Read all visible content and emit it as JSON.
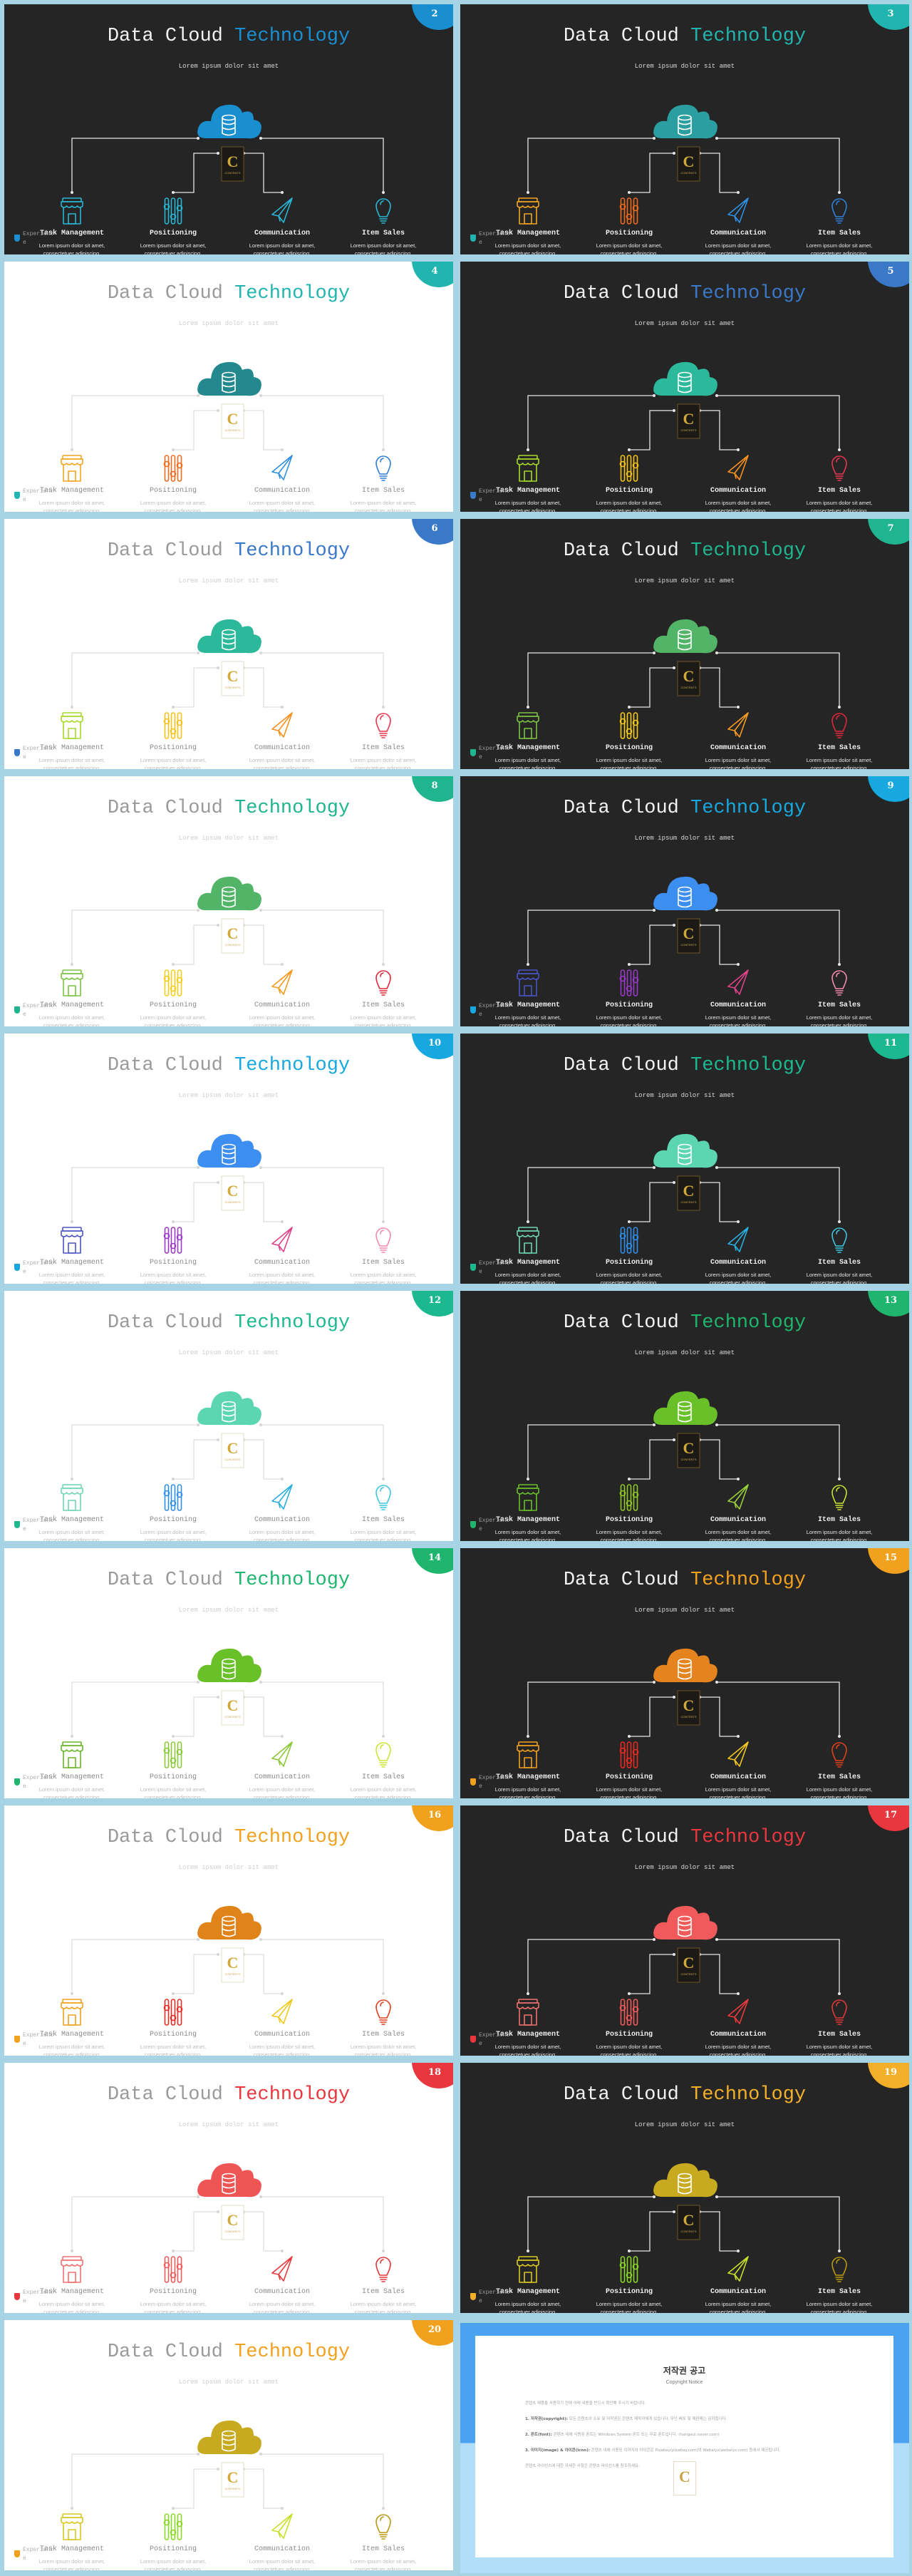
{
  "common": {
    "title_main": "Data Cloud",
    "title_accent": "Technology",
    "subtitle": "Lorem ipsum dolor sit amet",
    "items": [
      {
        "label": "Task Management",
        "icon": "store-icon",
        "desc_line1": "Lorem ipsum dolor sit amet,",
        "desc_line2": "consectetuer adipiscing."
      },
      {
        "label": "Positioning",
        "icon": "sliders-icon",
        "desc_line1": "Lorem ipsum dolor sit amet,",
        "desc_line2": "consectetuer adipiscing."
      },
      {
        "label": "Communication",
        "icon": "paper-plane-icon",
        "desc_line1": "Lorem ipsum dolor sit amet,",
        "desc_line2": "consectetuer adipiscing."
      },
      {
        "label": "Item Sales",
        "icon": "lightbulb-icon",
        "desc_line1": "Lorem ipsum dolor sit amet,",
        "desc_line2": "consectetuer adipiscing."
      }
    ],
    "center_icon": "database-cloud-icon",
    "logo_letter": "C",
    "logo_text": "CONTENTS",
    "footer_text": "Experience"
  },
  "slides": [
    {
      "number": "2",
      "theme": "dark",
      "accent": "#1a8fd0",
      "cloud": "#1a8fd0",
      "icons": [
        "#29b6d6",
        "#29b6d6",
        "#29b6d6",
        "#29b6d6"
      ]
    },
    {
      "number": "3",
      "theme": "dark",
      "accent": "#22b5b0",
      "cloud": "#2a9ea0",
      "icons": [
        "#f2a51f",
        "#f06a1e",
        "#2f8fe0",
        "#2f7fd6"
      ]
    },
    {
      "number": "4",
      "theme": "light",
      "accent": "#22b5b0",
      "cloud": "#24898f",
      "icons": [
        "#f2a51f",
        "#f06a1e",
        "#2f8fe0",
        "#2f7fd6"
      ]
    },
    {
      "number": "5",
      "theme": "dark",
      "accent": "#3a78c8",
      "cloud": "#2cb89a",
      "icons": [
        "#a8d82a",
        "#f5c21a",
        "#f6901e",
        "#e8364f"
      ]
    },
    {
      "number": "6",
      "theme": "light",
      "accent": "#3a78c8",
      "cloud": "#2cb89a",
      "icons": [
        "#a8d82a",
        "#f5c21a",
        "#f6901e",
        "#e8364f"
      ]
    },
    {
      "number": "7",
      "theme": "dark",
      "accent": "#1fb58f",
      "cloud": "#52b466",
      "icons": [
        "#7cc242",
        "#f6cc1a",
        "#f69a1e",
        "#e0283a"
      ]
    },
    {
      "number": "8",
      "theme": "light",
      "accent": "#1fb58f",
      "cloud": "#52b466",
      "icons": [
        "#7cc242",
        "#f6cc1a",
        "#f69a1e",
        "#e0283a"
      ]
    },
    {
      "number": "9",
      "theme": "dark",
      "accent": "#17a8e0",
      "cloud": "#3c8ef0",
      "icons": [
        "#4a54c8",
        "#9a38c8",
        "#e0428a",
        "#f28ab0"
      ]
    },
    {
      "number": "10",
      "theme": "light",
      "accent": "#17a8e0",
      "cloud": "#3c8ef0",
      "icons": [
        "#4a54c8",
        "#9a38c8",
        "#e0428a",
        "#f28ab0"
      ]
    },
    {
      "number": "11",
      "theme": "dark",
      "accent": "#1cb890",
      "cloud": "#5cd6b0",
      "icons": [
        "#6fd6b0",
        "#2f8fe8",
        "#29aee0",
        "#3cc6e0"
      ]
    },
    {
      "number": "12",
      "theme": "light",
      "accent": "#1cb890",
      "cloud": "#5cd6b0",
      "icons": [
        "#6fd6b0",
        "#2f8fe8",
        "#29aee0",
        "#3cc6e0"
      ]
    },
    {
      "number": "13",
      "theme": "dark",
      "accent": "#1fb56e",
      "cloud": "#6ac028",
      "icons": [
        "#6ac028",
        "#90c828",
        "#9ad03a",
        "#c8e030"
      ]
    },
    {
      "number": "14",
      "theme": "light",
      "accent": "#1fb56e",
      "cloud": "#6ac028",
      "icons": [
        "#6ab428",
        "#8ac838",
        "#8ac838",
        "#c8e838"
      ]
    },
    {
      "number": "15",
      "theme": "dark",
      "accent": "#f2a11f",
      "cloud": "#e5841e",
      "icons": [
        "#f2a01f",
        "#e82a22",
        "#f2c81f",
        "#e0401c"
      ]
    },
    {
      "number": "16",
      "theme": "light",
      "accent": "#f2a11f",
      "cloud": "#e0841a",
      "icons": [
        "#f2a01f",
        "#e82a22",
        "#f2c81f",
        "#e0401c"
      ]
    },
    {
      "number": "17",
      "theme": "dark",
      "accent": "#e8373f",
      "cloud": "#f05a5a",
      "icons": [
        "#f07070",
        "#f05a5a",
        "#e83a3a",
        "#e0383a"
      ]
    },
    {
      "number": "18",
      "theme": "light",
      "accent": "#e8373f",
      "cloud": "#f05555",
      "icons": [
        "#f07070",
        "#f05a5a",
        "#e83a3a",
        "#e0383a"
      ]
    },
    {
      "number": "19",
      "theme": "dark",
      "accent": "#f2b02a",
      "cloud": "#c8aa20",
      "icons": [
        "#d8c820",
        "#8ad828",
        "#c8e028",
        "#b89a10"
      ]
    },
    {
      "number": "20",
      "theme": "light",
      "accent": "#f2a11f",
      "cloud": "#c8aa20",
      "icons": [
        "#d8c820",
        "#8ad828",
        "#c8e028",
        "#b89a10"
      ]
    }
  ],
  "copyright": {
    "title": "저작권 공고",
    "subtitle": "Copyright Notice",
    "intro": "콘텐츠 제품을 사용하기 전에 아래 내용을 반드시 확인해 주시기 바랍니다.",
    "sections": [
      {
        "heading": "1. 저작권(copyright):",
        "text": "모든 콘텐츠의 소유 및 저작권은 콘텐츠 제작자에게 있습니다. 무단 배포 및 재판매는 금지됩니다."
      },
      {
        "heading": "2. 폰트(font):",
        "text": "콘텐츠 내에 사용된 폰트는 Windows System 폰트 또는 무료 폰트입니다. (hangeul.naver.com)"
      },
      {
        "heading": "3. 이미지(image) & 아이콘(icon):",
        "text": "콘텐츠 내에 사용된 이미지와 아이콘은 Pixabay(pixabay.com)와 Webalys(webalys.com) 등에서 제공됩니다."
      }
    ],
    "outro": "콘텐츠 라이선스에 대한 자세한 사항은 콘텐츠 라이선스를 참조하세요."
  }
}
